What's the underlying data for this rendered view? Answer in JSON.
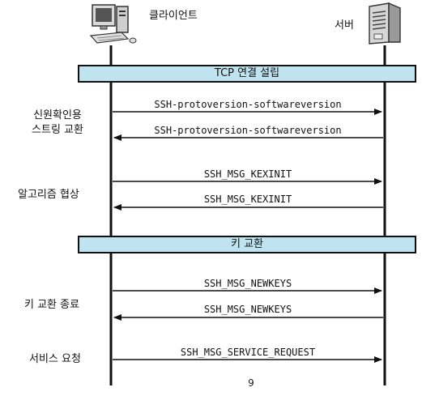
{
  "actors": {
    "client": "클라이언트",
    "server": "서버"
  },
  "phases": [
    {
      "band": "TCP 연결 설립"
    },
    {
      "label_line1": "신원확인용",
      "label_line2": "스트링 교환"
    },
    {
      "label": "알고리즘 협상"
    },
    {
      "band": "키 교환"
    },
    {
      "label": "키 교환 종료"
    },
    {
      "label": "서비스 요청"
    }
  ],
  "messages": [
    {
      "text": "SSH-protoversion-softwareversion",
      "direction": "client-to-server"
    },
    {
      "text": "SSH-protoversion-softwareversion",
      "direction": "server-to-client"
    },
    {
      "text": "SSH_MSG_KEXINIT",
      "direction": "client-to-server"
    },
    {
      "text": "SSH_MSG_KEXINIT",
      "direction": "server-to-client"
    },
    {
      "text": "SSH_MSG_NEWKEYS",
      "direction": "client-to-server"
    },
    {
      "text": "SSH_MSG_NEWKEYS",
      "direction": "server-to-client"
    },
    {
      "text": "SSH_MSG_SERVICE_REQUEST",
      "direction": "client-to-server"
    }
  ],
  "page_number": "9"
}
